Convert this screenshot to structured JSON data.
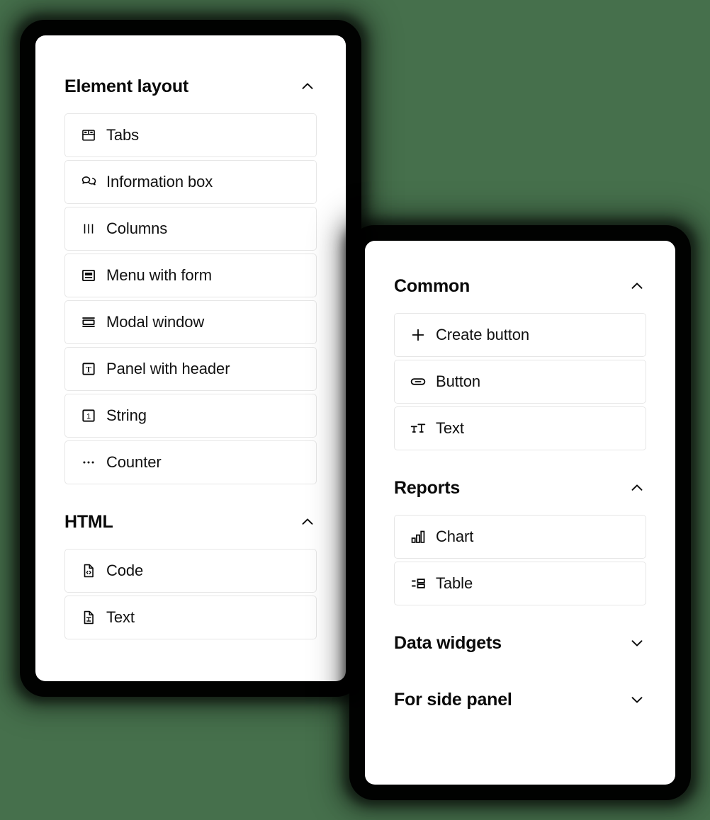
{
  "theme": {
    "background": "#46704c",
    "card_background": "#ffffff",
    "text_color": "#111111",
    "border_color": "#e6e6e6"
  },
  "panels": [
    {
      "id": "left",
      "sections": [
        {
          "title": "Element layout",
          "expanded": true,
          "chevron": "chevron-up-icon",
          "items": [
            {
              "label": "Tabs",
              "icon": "tabs-icon"
            },
            {
              "label": "Information box",
              "icon": "speech-bubbles-icon"
            },
            {
              "label": "Columns",
              "icon": "columns-icon"
            },
            {
              "label": "Menu with form",
              "icon": "menu-with-form-icon"
            },
            {
              "label": "Modal window",
              "icon": "modal-window-icon"
            },
            {
              "label": "Panel with header",
              "icon": "letter-t-box-icon"
            },
            {
              "label": "String",
              "icon": "number-one-box-icon"
            },
            {
              "label": "Counter",
              "icon": "ellipsis-icon"
            }
          ]
        },
        {
          "title": "HTML",
          "expanded": true,
          "chevron": "chevron-up-icon",
          "items": [
            {
              "label": "Code",
              "icon": "file-code-icon"
            },
            {
              "label": "Text",
              "icon": "file-text-icon"
            }
          ]
        }
      ]
    },
    {
      "id": "right",
      "sections": [
        {
          "title": "Common",
          "expanded": true,
          "chevron": "chevron-up-icon",
          "items": [
            {
              "label": "Create button",
              "icon": "plus-icon"
            },
            {
              "label": "Button",
              "icon": "pill-button-icon"
            },
            {
              "label": "Text",
              "icon": "text-size-icon"
            }
          ]
        },
        {
          "title": "Reports",
          "expanded": true,
          "chevron": "chevron-up-icon",
          "items": [
            {
              "label": "Chart",
              "icon": "bar-chart-icon"
            },
            {
              "label": "Table",
              "icon": "table-layout-icon"
            }
          ]
        },
        {
          "title": "Data widgets",
          "expanded": false,
          "chevron": "chevron-down-icon",
          "items": []
        },
        {
          "title": "For side panel",
          "expanded": false,
          "chevron": "chevron-down-icon",
          "items": []
        }
      ]
    }
  ]
}
